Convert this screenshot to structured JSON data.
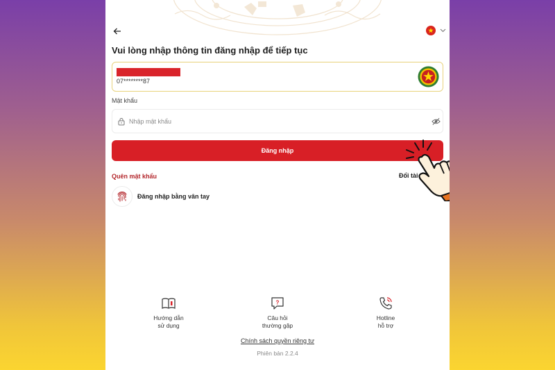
{
  "header": {
    "language_flag": "vn-flag-icon"
  },
  "login": {
    "title": "Vui lòng nhập thông tin đăng nhập để tiếp tục",
    "account_masked": "07********87",
    "password_label": "Mật khẩu",
    "password_placeholder": "Nhập mật khẩu",
    "password_value": "",
    "login_button": "Đăng nhập",
    "forgot_password": "Quên mật khẩu",
    "switch_account": "Đổi tài khoản",
    "fingerprint_login": "Đăng nhập bằng vân tay"
  },
  "footer": {
    "items": [
      {
        "label": "Hướng dẫn\nsử dụng",
        "icon": "book-icon"
      },
      {
        "label": "Câu hỏi\nthường gặp",
        "icon": "question-chat-icon"
      },
      {
        "label": "Hotline\nhỗ trợ",
        "icon": "phone-ringing-icon"
      }
    ],
    "privacy": "Chính sách quyền riêng tư",
    "version": "Phiên bản 2.2.4"
  },
  "colors": {
    "primary": "#d81f26",
    "accent_border": "#e8d27a",
    "forgot_text": "#b3262b",
    "background_top": "#7a3fa8",
    "background_bottom": "#fbd530"
  }
}
